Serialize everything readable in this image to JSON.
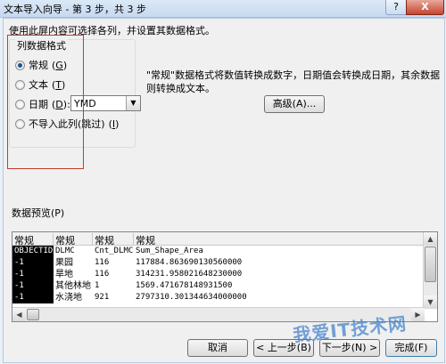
{
  "window": {
    "title": "文本导入向导 - 第 3 步，共 3 步",
    "help_label": "?",
    "close_label": "X"
  },
  "instruction": "使用此屏内容可选择各列，并设置其数据格式。",
  "column_format": {
    "legend": "列数据格式",
    "options": [
      {
        "label": "常规",
        "key": "G",
        "checked": true
      },
      {
        "label": "文本",
        "key": "T",
        "checked": false
      },
      {
        "label": "日期",
        "key": "D",
        "checked": false
      },
      {
        "label": "不导入此列(跳过)",
        "key": "I",
        "checked": false
      }
    ],
    "date_value": "YMD"
  },
  "description": "\"常规\"数据格式将数值转换成数字，日期值会转换成日期，其余数据则转换成文本。",
  "advanced_button": "高级(A)...",
  "preview": {
    "label": "数据预览(P)",
    "headers": [
      "常规",
      "常规",
      "常规",
      "常规"
    ],
    "rows": [
      [
        "OBJECTID",
        "DLMC",
        "Cnt_DLMC",
        "Sum_Shape_Area"
      ],
      [
        "-1",
        "果园",
        "116",
        "117884.863690130560000"
      ],
      [
        "-1",
        "旱地",
        "116",
        "314231.958021648230000"
      ],
      [
        "-1",
        "其他林地",
        "1",
        "1569.471678148931500"
      ],
      [
        "-1",
        "水浇地",
        "921",
        "2797310.301344634000000"
      ]
    ]
  },
  "buttons": {
    "cancel": "取消",
    "back": "< 上一步(B)",
    "next": "下一步(N) >",
    "finish": "完成(F)"
  },
  "watermark": "我爱IT技术网"
}
